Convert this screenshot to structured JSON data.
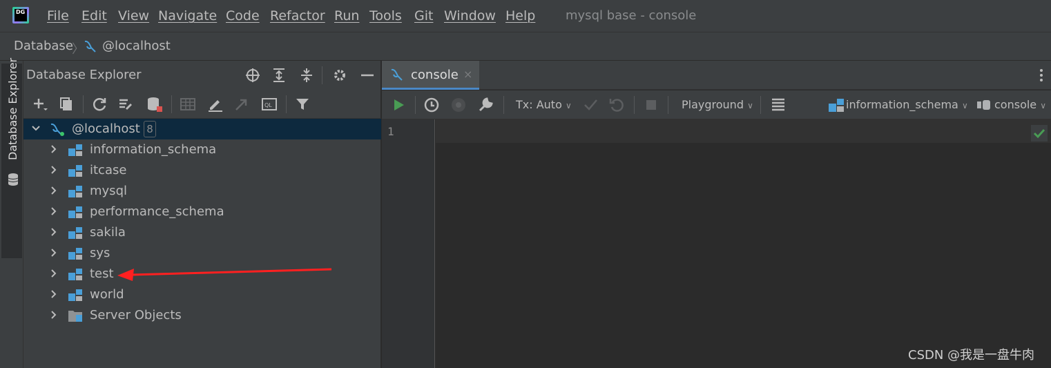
{
  "app": {
    "logo_text": "DG",
    "window_title": "mysql base - console"
  },
  "menu": [
    "File",
    "Edit",
    "View",
    "Navigate",
    "Code",
    "Refactor",
    "Run",
    "Tools",
    "Git",
    "Window",
    "Help"
  ],
  "breadcrumb": [
    "Database",
    "@localhost"
  ],
  "tool_window_tab": "Database Explorer",
  "explorer": {
    "title": "Database Explorer",
    "root": {
      "label": "@localhost",
      "count": "8"
    },
    "schemas": [
      "information_schema",
      "itcase",
      "mysql",
      "performance_schema",
      "sakila",
      "sys",
      "test",
      "world"
    ],
    "server_objects": "Server Objects"
  },
  "editor": {
    "tab_label": "console",
    "tab_close": "×",
    "tx_mode": "Tx: Auto",
    "mode": "Playground",
    "schema": "information_schema",
    "session": "console",
    "line_numbers": [
      "1"
    ]
  },
  "watermark": "CSDN @我是一盘牛肉",
  "colors": {
    "accent": "#4a88c7",
    "selection": "#0d293e",
    "run_green": "#499c54",
    "annotation_red": "#ff2020"
  }
}
